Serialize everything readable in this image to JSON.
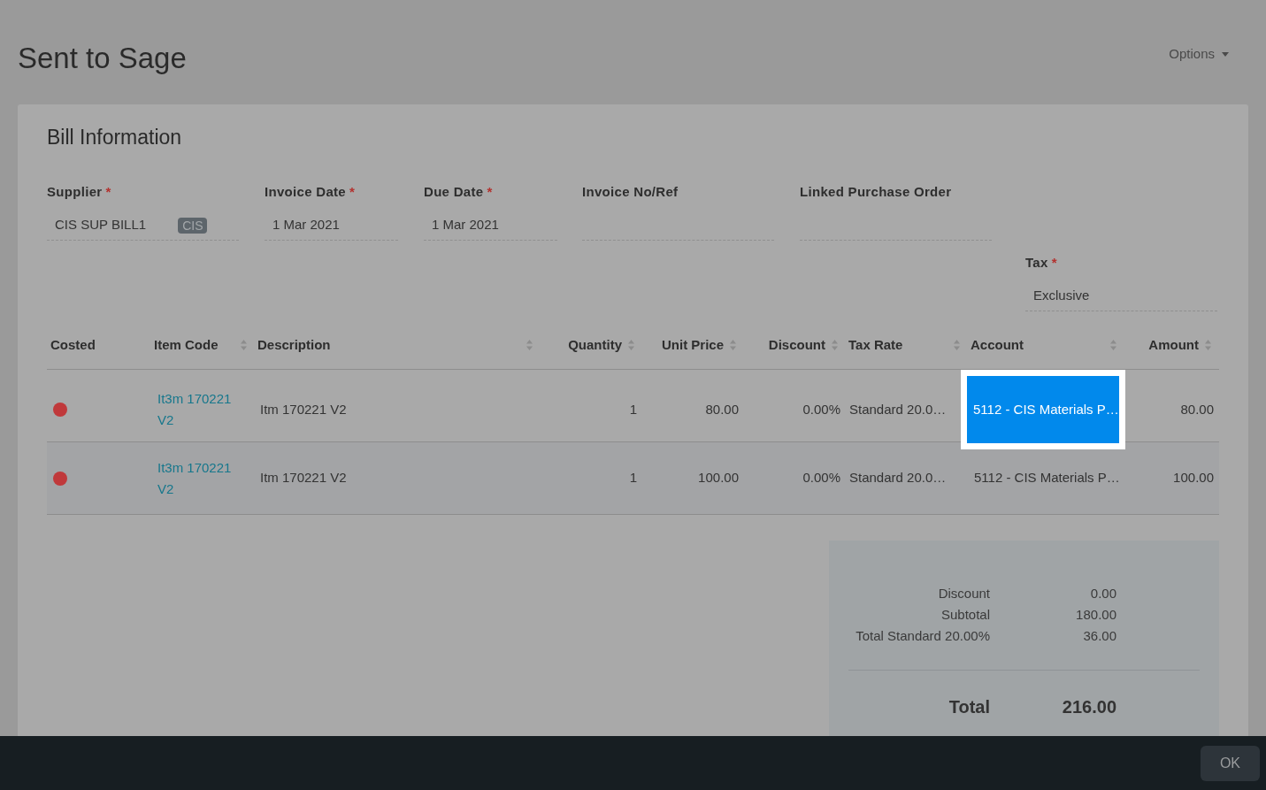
{
  "page": {
    "title": "Sent to Sage",
    "options_label": "Options"
  },
  "card": {
    "title": "Bill Information"
  },
  "fields": [
    {
      "label": "Supplier",
      "required_mark": "*",
      "value": "CIS SUP BILL1",
      "badge": "CIS"
    },
    {
      "label": "Invoice Date",
      "required_mark": "*",
      "value": "1 Mar 2021"
    },
    {
      "label": "Due Date",
      "required_mark": "*",
      "value": "1 Mar 2021"
    },
    {
      "label": "Invoice No/Ref"
    },
    {
      "label": "Linked Purchase Order"
    }
  ],
  "tax_field": {
    "label": "Tax",
    "required_mark": "*",
    "value": "Exclusive"
  },
  "table": {
    "columns": [
      {
        "label": "Costed",
        "sortable": false
      },
      {
        "label": "Item Code",
        "sortable": true
      },
      {
        "label": "Description",
        "sortable": true
      },
      {
        "label": "Quantity",
        "sortable": true
      },
      {
        "label": "Unit Price",
        "sortable": true
      },
      {
        "label": "Discount",
        "sortable": true
      },
      {
        "label": "Tax Rate",
        "sortable": true
      },
      {
        "label": "Account",
        "sortable": true
      },
      {
        "label": "Amount",
        "sortable": true
      }
    ],
    "rows": [
      {
        "costed": false,
        "item_code": "It3m 170221 V2",
        "description": "Itm 170221 V2",
        "quantity": "1",
        "unit_price": "80.00",
        "discount": "0.00%",
        "tax_rate": "Standard 20.0…",
        "account": "5112 - CIS Materials P…",
        "amount": "80.00",
        "account_highlighted": true
      },
      {
        "costed": false,
        "item_code": "It3m 170221 V2",
        "description": "Itm 170221 V2",
        "quantity": "1",
        "unit_price": "100.00",
        "discount": "0.00%",
        "tax_rate": "Standard 20.0…",
        "account": "5112 - CIS Materials P…",
        "amount": "100.00",
        "account_highlighted": false
      }
    ]
  },
  "totals": {
    "lines": [
      {
        "label": "Discount",
        "value": "0.00"
      },
      {
        "label": "Subtotal",
        "value": "180.00"
      },
      {
        "label": "Total Standard 20.00%",
        "value": "36.00"
      }
    ],
    "total": {
      "label": "Total",
      "value": "216.00"
    }
  },
  "footer": {
    "button": "OK"
  }
}
